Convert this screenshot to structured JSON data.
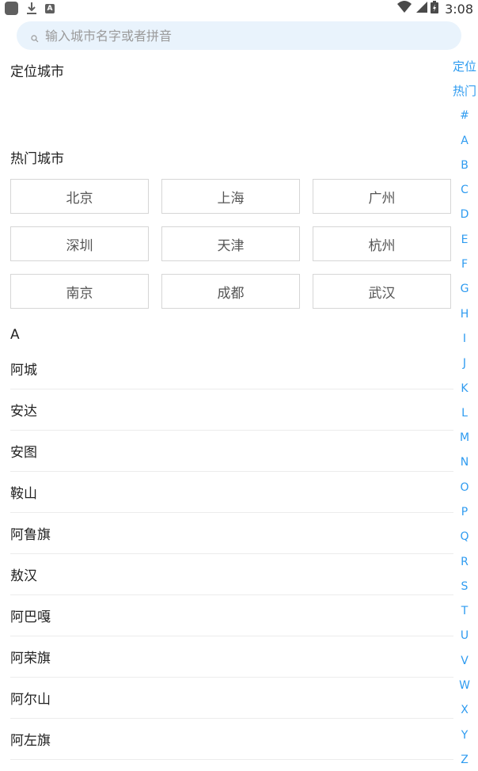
{
  "status_bar": {
    "time": "3:08",
    "left_icons": [
      "app-icon",
      "download-icon",
      "a-icon"
    ],
    "right_icons": [
      "wifi-icon",
      "signal-icon",
      "battery-icon"
    ],
    "a_icon_glyph": "A"
  },
  "search": {
    "placeholder": "输入城市名字或者拼音",
    "value": ""
  },
  "sections": {
    "located_title": "定位城市",
    "hot_title": "热门城市"
  },
  "hot_cities": [
    "北京",
    "上海",
    "广州",
    "深圳",
    "天津",
    "杭州",
    "南京",
    "成都",
    "武汉"
  ],
  "city_group": {
    "letter": "A",
    "cities": [
      "阿城",
      "安达",
      "安图",
      "鞍山",
      "阿鲁旗",
      "敖汉",
      "阿巴嘎",
      "阿荣旗",
      "阿尔山",
      "阿左旗"
    ]
  },
  "index_bar": [
    "定位",
    "热门",
    "#",
    "A",
    "B",
    "C",
    "D",
    "E",
    "F",
    "G",
    "H",
    "I",
    "J",
    "K",
    "L",
    "M",
    "N",
    "O",
    "P",
    "Q",
    "R",
    "S",
    "T",
    "U",
    "V",
    "W",
    "X",
    "Y",
    "Z"
  ],
  "colors": {
    "accent": "#2e9bf0",
    "search_bg": "#e9f3fc",
    "button_border": "#d6d6d6",
    "divider": "#ececec"
  }
}
